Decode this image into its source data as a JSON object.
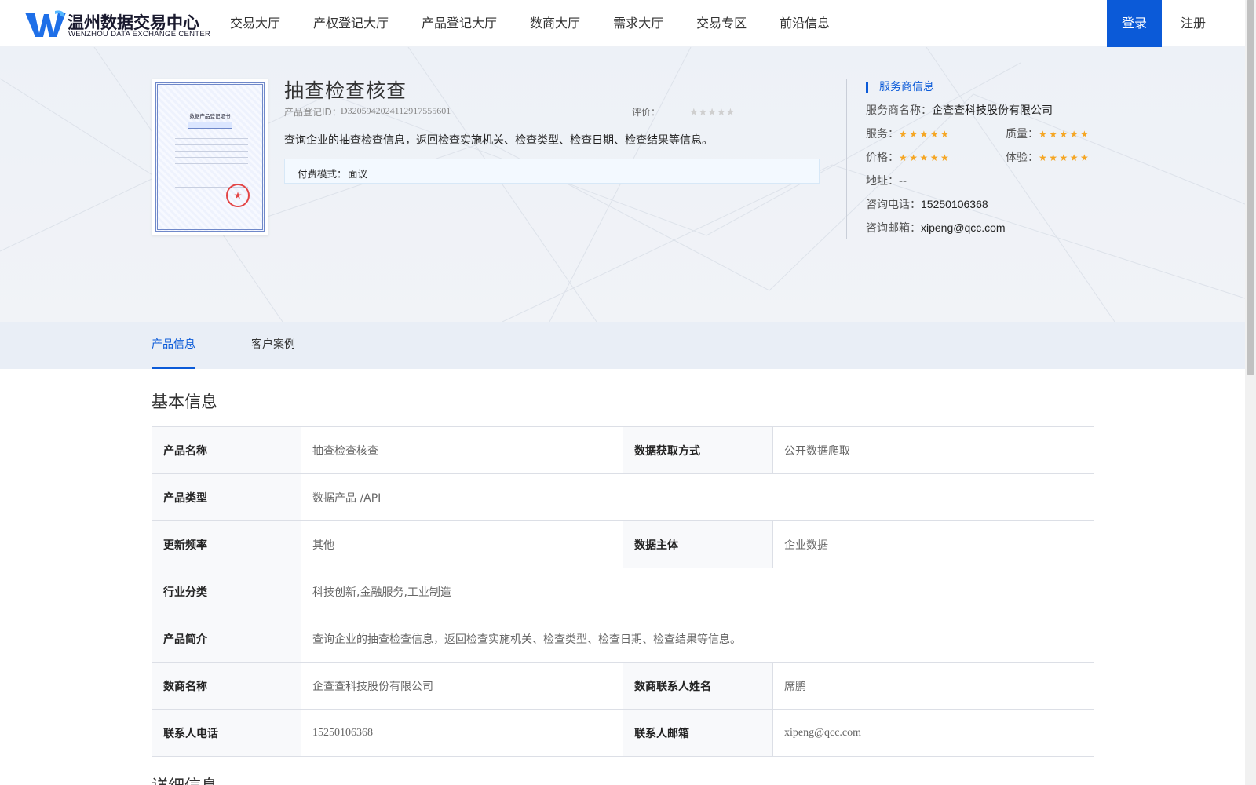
{
  "header": {
    "logo_cn": "温州数据交易中心",
    "logo_en": "WENZHOU DATA EXCHANGE CENTER",
    "nav": [
      "交易大厅",
      "产权登记大厅",
      "产品登记大厅",
      "数商大厅",
      "需求大厅",
      "交易专区",
      "前沿信息"
    ],
    "login": "登录",
    "register": "注册"
  },
  "product": {
    "title": "抽查检查核查",
    "id_label": "产品登记ID：",
    "id": "D320594202411291 7555601",
    "rating_label": "评价：",
    "rating_stars": "★★★★★",
    "description": "查询企业的抽查检查信息，返回检查实施机关、检查类型、检查日期、检查结果等信息。",
    "fee_label": "付费模式：",
    "fee_value": "面议"
  },
  "service_provider": {
    "heading": "服务商信息",
    "name_label": "服务商名称：",
    "name": "企查查科技股份有限公司",
    "service_label": "服务：",
    "quality_label": "质量：",
    "price_label": "价格：",
    "experience_label": "体验：",
    "stars": "★★★★★",
    "service_rating": 5,
    "quality_rating": 5,
    "price_rating": 5,
    "experience_rating": 5,
    "address_label": "地址：",
    "address": "--",
    "phone_label": "咨询电话：",
    "phone": "15250106368",
    "email_label": "咨询邮箱：",
    "email": "xipeng@qcc.com"
  },
  "tabs": [
    "产品信息",
    "客户案例"
  ],
  "basic_info": {
    "title": "基本信息",
    "rows": [
      {
        "label1": "产品名称",
        "value1": "抽查检查核查",
        "label2": "数据获取方式",
        "value2": "公开数据爬取"
      },
      {
        "label1": "产品类型",
        "value1": "数据产品 /API"
      },
      {
        "label1": "更新频率",
        "value1": "其他",
        "label2": "数据主体",
        "value2": "企业数据"
      },
      {
        "label1": "行业分类",
        "value1": "科技创新,金融服务,工业制造"
      },
      {
        "label1": "产品简介",
        "value1": "查询企业的抽查检查信息，返回检查实施机关、检查类型、检查日期、检查结果等信息。"
      },
      {
        "label1": "数商名称",
        "value1": "企查查科技股份有限公司",
        "label2": "数商联系人姓名",
        "value2": "席鹏"
      },
      {
        "label1": "联系人电话",
        "value1": "15250106368",
        "label2": "联系人邮箱",
        "value2": "xipeng@qcc.com"
      }
    ]
  },
  "detail_info": {
    "title": "详细信息"
  },
  "certificate": {
    "title": "数据产品登记证书"
  }
}
